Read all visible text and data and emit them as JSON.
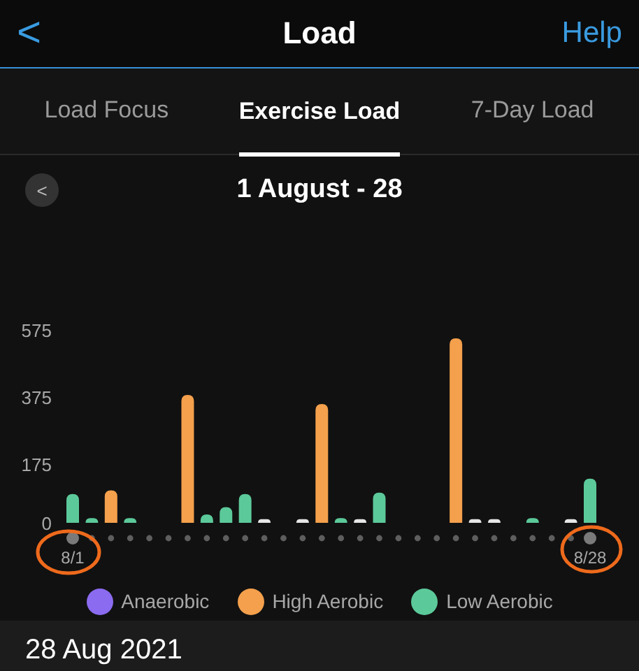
{
  "header": {
    "back": "<",
    "title": "Load",
    "help": "Help"
  },
  "tabs": [
    {
      "label": "Load Focus",
      "selected": false
    },
    {
      "label": "Exercise Load",
      "selected": true
    },
    {
      "label": "7-Day Load",
      "selected": false
    }
  ],
  "period": {
    "prev": "<",
    "title": "1 August - 28"
  },
  "chart_data": {
    "type": "bar",
    "stacked": false,
    "ylim": [
      0,
      575
    ],
    "yticks": [
      0,
      175,
      375,
      575
    ],
    "categories": [
      "8/1",
      null,
      null,
      null,
      null,
      null,
      null,
      null,
      null,
      null,
      null,
      null,
      null,
      null,
      null,
      null,
      null,
      null,
      null,
      null,
      null,
      null,
      null,
      null,
      null,
      null,
      null,
      "8/28"
    ],
    "series": [
      {
        "name": "Anaerobic",
        "color": "#8b6cf0",
        "values": [
          null,
          null,
          null,
          null,
          null,
          null,
          null,
          null,
          null,
          null,
          null,
          null,
          null,
          null,
          null,
          null,
          null,
          null,
          null,
          null,
          null,
          null,
          null,
          null,
          null,
          null,
          null,
          null
        ]
      },
      {
        "name": "High Aerobic",
        "color": "#f4a04c",
        "values": [
          null,
          null,
          97,
          null,
          null,
          null,
          381,
          null,
          null,
          null,
          null,
          null,
          null,
          354,
          null,
          null,
          null,
          null,
          null,
          null,
          550,
          null,
          null,
          null,
          null,
          null,
          null,
          null
        ]
      },
      {
        "name": "Low Aerobic",
        "color": "#5cc99a",
        "values": [
          86,
          14,
          null,
          14,
          null,
          null,
          null,
          25,
          47,
          86,
          null,
          null,
          null,
          null,
          14,
          null,
          90,
          null,
          null,
          null,
          null,
          null,
          null,
          null,
          14,
          null,
          null,
          132
        ]
      },
      {
        "color": "#e6e6e6",
        "values": [
          null,
          null,
          null,
          null,
          null,
          null,
          null,
          null,
          null,
          null,
          11,
          null,
          11,
          null,
          null,
          11,
          null,
          null,
          null,
          null,
          null,
          11,
          11,
          null,
          null,
          null,
          11,
          null
        ]
      }
    ]
  },
  "detail": {
    "date": "28 Aug 2021"
  }
}
